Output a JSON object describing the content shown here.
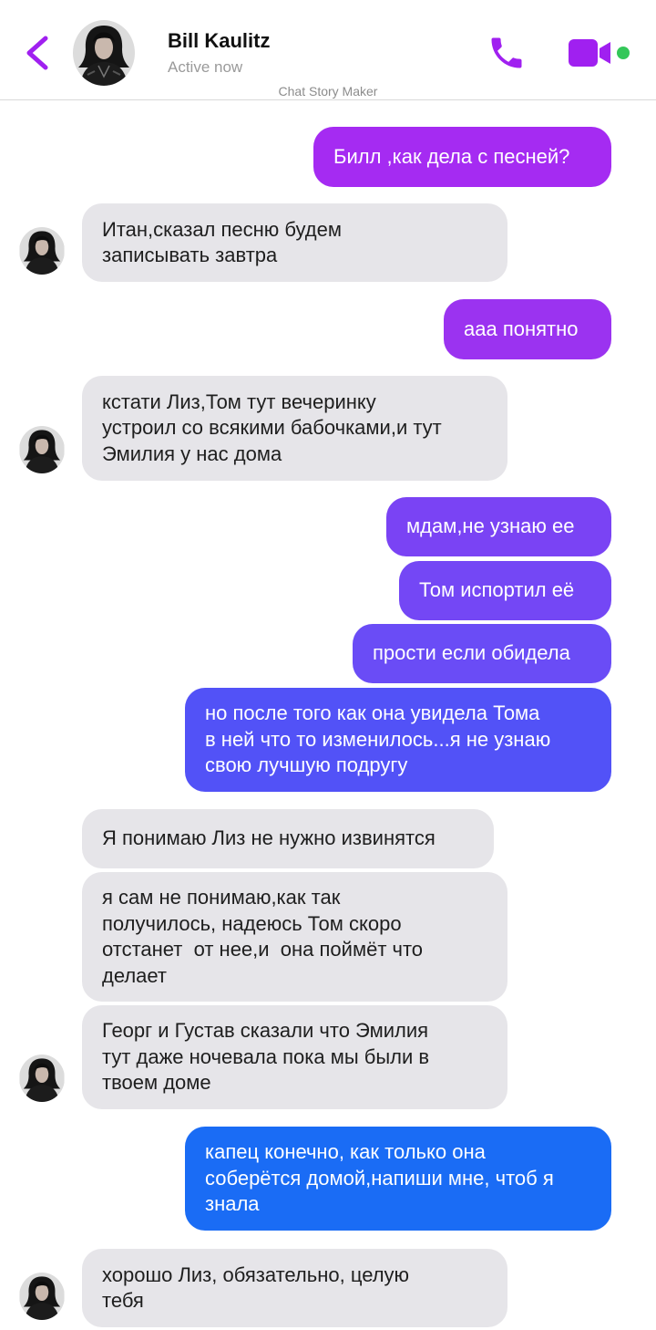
{
  "header": {
    "contact_name": "Bill Kaulitz",
    "status": "Active now",
    "watermark": "Chat Story Maker",
    "accent_color": "#a020f0",
    "online_color": "#34c759",
    "icons": [
      "chevron-left-icon",
      "phone-icon",
      "video-camera-icon"
    ]
  },
  "messages": [
    {
      "side": "out",
      "text": "Билл ,как дела с песней?",
      "color": "#a52bf2"
    },
    {
      "side": "in",
      "text": "Итан,сказал песню будем\nзаписывать завтра",
      "avatar": true
    },
    {
      "side": "out",
      "text": "ааа понятно",
      "color": "#9b33f0"
    },
    {
      "side": "in",
      "text": "кстати Лиз,Том тут вечеринку\nустроил со всякими бабочками,и тут\nЭмилия у нас дома",
      "avatar": true
    },
    {
      "side": "out",
      "text": "мдам,не узнаю ее",
      "color": "#7a43f4"
    },
    {
      "side": "out",
      "text": "Том испортил её",
      "color": "#7447f5"
    },
    {
      "side": "out",
      "text": "прости если обидела",
      "color": "#6a4cf6"
    },
    {
      "side": "out",
      "text": "но после того как она увидела Тома\nв ней что то изменилось...я не узнаю\nсвою лучшую подругу",
      "color": "#5252f7"
    },
    {
      "side": "in",
      "text": "Я понимаю Лиз не нужно извинятся",
      "avatar": false
    },
    {
      "side": "in",
      "text": "я сам не понимаю,как так\nполучилось, надеюсь Том скоро\nотстанет  от нее,и  она поймёт что\nделает",
      "avatar": false
    },
    {
      "side": "in",
      "text": "Георг и Густав сказали что Эмилия\nтут даже ночевала пока мы были в\nтвоем доме",
      "avatar": true
    },
    {
      "side": "out",
      "text": "капец конечно, как только она\nсоберётся домой,напиши мне, чтоб я\nзнала",
      "color": "#1a6cf5"
    },
    {
      "side": "in",
      "text": "хорошо Лиз, обязательно, целую\nтебя",
      "avatar": true
    }
  ]
}
